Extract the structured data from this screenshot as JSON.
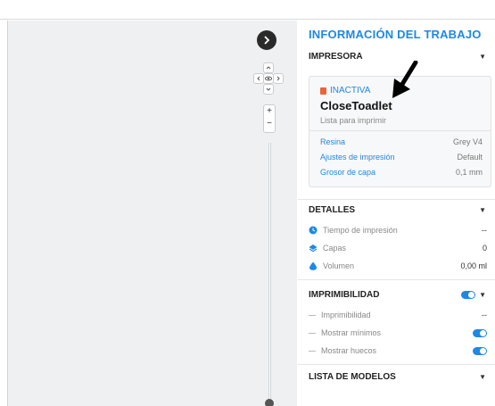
{
  "panel": {
    "title": "INFORMACIÓN DEL TRABAJO"
  },
  "printer": {
    "section_label": "IMPRESORA",
    "status": "INACTIVA",
    "name": "CloseToadlet",
    "subtitle": "Lista para imprimir",
    "settings": [
      {
        "key": "Resina",
        "value": "Grey V4"
      },
      {
        "key": "Ajustes de impresión",
        "value": "Default"
      },
      {
        "key": "Grosor de capa",
        "value": "0,1 mm"
      }
    ]
  },
  "details": {
    "section_label": "DETALLES",
    "rows": [
      {
        "label": "Tiempo de impresión",
        "value": "--",
        "icon": "clock-icon"
      },
      {
        "label": "Capas",
        "value": "0",
        "icon": "layers-icon"
      },
      {
        "label": "Volumen",
        "value": "0,00 ml",
        "icon": "volume-icon"
      }
    ]
  },
  "printability": {
    "section_label": "IMPRIMIBILIDAD",
    "rows": [
      {
        "label": "Imprimibilidad",
        "value": "--"
      },
      {
        "label": "Mostrar mínimos",
        "toggle": true
      },
      {
        "label": "Mostrar huecos",
        "toggle": true
      }
    ]
  },
  "models": {
    "section_label": "LISTA DE MODELOS"
  },
  "colors": {
    "accent": "#1e88e5",
    "status_dot": "#e8643a"
  },
  "viewport": {
    "zoom_in": "+",
    "zoom_out": "−"
  }
}
